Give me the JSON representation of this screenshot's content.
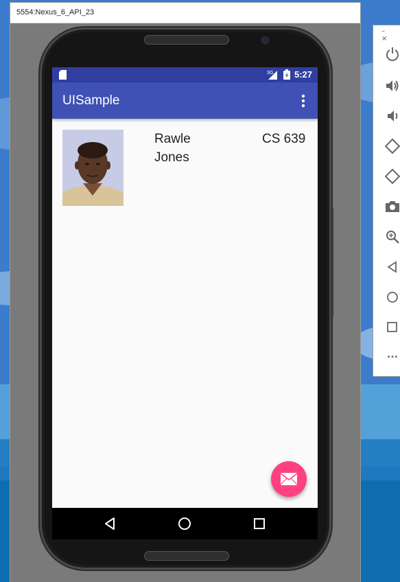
{
  "window": {
    "title": "5554:Nexus_6_API_23",
    "minimize": "–",
    "close": "×"
  },
  "status_bar": {
    "network": "3G",
    "time": "5:27",
    "icons": [
      "sd-card-icon",
      "network-signal-icon",
      "battery-icon"
    ]
  },
  "app_bar": {
    "title": "UISample",
    "menu_icon": "overflow-menu-icon"
  },
  "content": {
    "photo_icon": "profile-photo",
    "name_first": "Rawle",
    "name_last": "Jones",
    "course": "CS 639"
  },
  "fab": {
    "icon": "email-icon"
  },
  "nav_bar": {
    "icons": [
      "back-icon",
      "home-icon",
      "recents-icon"
    ]
  },
  "emulator_controls": {
    "icons": [
      "power-icon",
      "volume-up-icon",
      "volume-down-icon",
      "rotate-left-icon",
      "rotate-right-icon",
      "camera-icon",
      "zoom-icon",
      "back-icon",
      "home-icon",
      "overview-icon",
      "more-icon"
    ],
    "more_label": "..."
  },
  "colors": {
    "primary": "#3f51b5",
    "primary_dark": "#303f9f",
    "accent": "#ff4081"
  }
}
